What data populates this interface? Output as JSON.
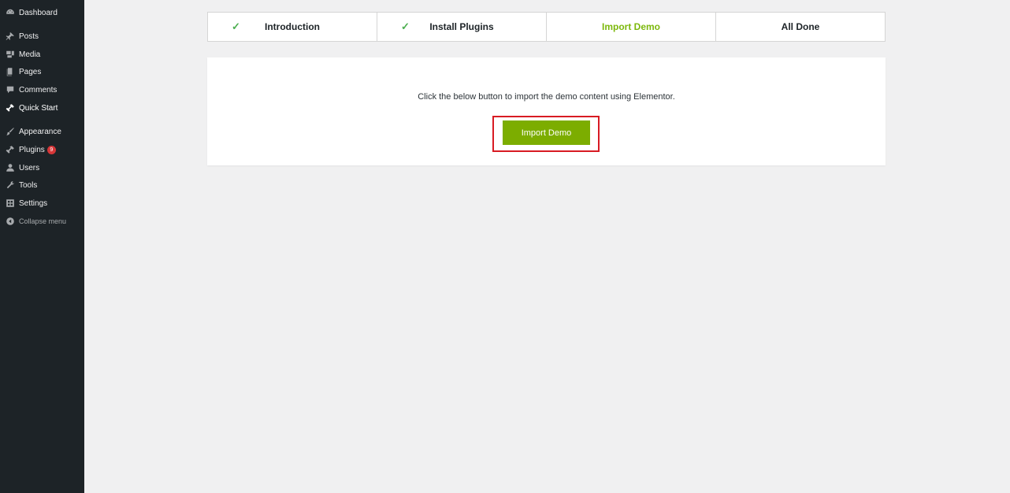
{
  "sidebar": {
    "items": [
      {
        "label": "Dashboard",
        "icon": "dashboard-icon"
      },
      {
        "label": "Posts",
        "icon": "pin-icon"
      },
      {
        "label": "Media",
        "icon": "media-icon"
      },
      {
        "label": "Pages",
        "icon": "pages-icon"
      },
      {
        "label": "Comments",
        "icon": "comments-icon"
      },
      {
        "label": "Quick Start",
        "icon": "quick-start-icon"
      },
      {
        "label": "Appearance",
        "icon": "brush-icon"
      },
      {
        "label": "Plugins",
        "icon": "plugins-icon",
        "badge": "9"
      },
      {
        "label": "Users",
        "icon": "users-icon"
      },
      {
        "label": "Tools",
        "icon": "wrench-icon"
      },
      {
        "label": "Settings",
        "icon": "settings-icon"
      },
      {
        "label": "Collapse menu",
        "icon": "collapse-icon"
      }
    ]
  },
  "steps": [
    {
      "label": "Introduction",
      "status": "done",
      "check": "✓"
    },
    {
      "label": "Install Plugins",
      "status": "done",
      "check": "✓"
    },
    {
      "label": "Import Demo",
      "status": "current"
    },
    {
      "label": "All Done",
      "status": "pending"
    }
  ],
  "content": {
    "description": "Click the below button to import the demo content using Elementor.",
    "button_label": "Import Demo"
  },
  "colors": {
    "sidebar_bg": "#1d2327",
    "accent_green": "#7cad00",
    "current_step": "#7cb80c",
    "check_green": "#4caf50",
    "highlight_red": "#d81b23",
    "badge_red": "#d63638"
  }
}
